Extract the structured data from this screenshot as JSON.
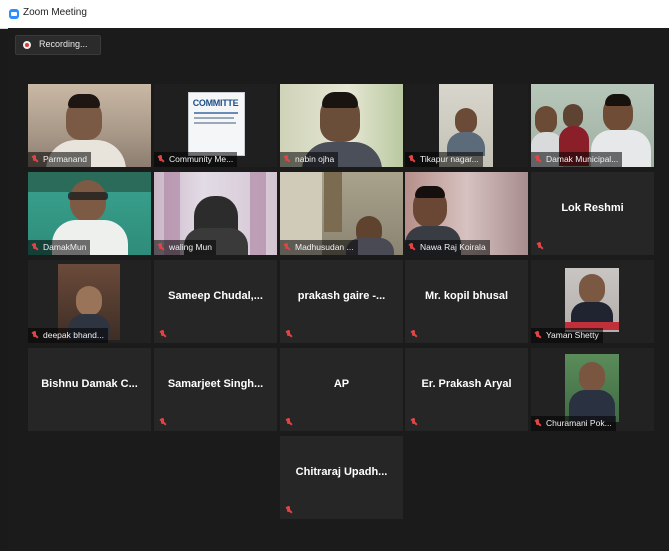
{
  "window": {
    "title": "Zoom Meeting"
  },
  "recording": {
    "label": "Recording..."
  },
  "participants": [
    {
      "name": "Parmanand",
      "video": true
    },
    {
      "name": "Community Me...",
      "video": true,
      "logo_text": "COMMITTE"
    },
    {
      "name": "nabin ojha",
      "video": true
    },
    {
      "name": "Tikapur nagar...",
      "video": true
    },
    {
      "name": "Damak Municipal...",
      "video": true,
      "active_speaker": true
    },
    {
      "name": "DamakMun",
      "video": true
    },
    {
      "name": "waling Mun",
      "video": true
    },
    {
      "name": "Madhusudan ...",
      "video": true
    },
    {
      "name": "Nawa Raj Koirala",
      "video": true
    },
    {
      "name": "Lok Reshmi",
      "video": false
    },
    {
      "name": "deepak bhand...",
      "video": true
    },
    {
      "name": "Sameep Chudal,...",
      "video": false
    },
    {
      "name": "prakash gaire -...",
      "video": false
    },
    {
      "name": "Mr. kopil bhusal",
      "video": false
    },
    {
      "name": "Yaman Shetty",
      "video": true
    },
    {
      "name": "Bishnu Damak C...",
      "video": false
    },
    {
      "name": "Samarjeet Singh...",
      "video": false
    },
    {
      "name": "AP",
      "video": false
    },
    {
      "name": "Er. Prakash Aryal",
      "video": false
    },
    {
      "name": "Churamani Pok...",
      "video": true
    },
    {
      "name": "Chitraraj Upadh...",
      "video": false
    }
  ],
  "colors": {
    "active_speaker": "#c8e04a",
    "muted_mic": "#e04444",
    "background": "#1b1b1b",
    "tile": "#262626"
  },
  "icons": {
    "app": "zoom-icon",
    "recording": "record-dot-icon",
    "mic": "muted-mic-icon"
  }
}
